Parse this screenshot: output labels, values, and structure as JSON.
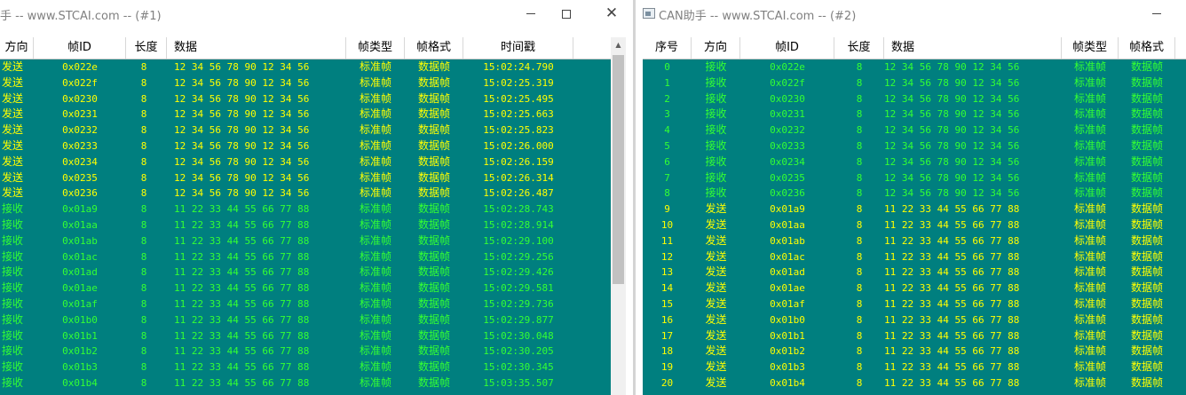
{
  "win1": {
    "title": "手 -- www.STCAI.com -- (#1)",
    "buttons": {
      "minimize": "minimize",
      "maximize": "maximize",
      "close": "close"
    },
    "columns": [
      "方向",
      "帧ID",
      "长度",
      "数据",
      "帧类型",
      "帧格式",
      "时间戳"
    ],
    "rows": [
      {
        "dir": "发送",
        "id": "0x022e",
        "len": "8",
        "data": "12 34 56 78 90 12 34 56",
        "type": "标准帧",
        "fmt": "数据帧",
        "ts": "15:02:24.790",
        "kind": "send"
      },
      {
        "dir": "发送",
        "id": "0x022f",
        "len": "8",
        "data": "12 34 56 78 90 12 34 56",
        "type": "标准帧",
        "fmt": "数据帧",
        "ts": "15:02:25.319",
        "kind": "send"
      },
      {
        "dir": "发送",
        "id": "0x0230",
        "len": "8",
        "data": "12 34 56 78 90 12 34 56",
        "type": "标准帧",
        "fmt": "数据帧",
        "ts": "15:02:25.495",
        "kind": "send"
      },
      {
        "dir": "发送",
        "id": "0x0231",
        "len": "8",
        "data": "12 34 56 78 90 12 34 56",
        "type": "标准帧",
        "fmt": "数据帧",
        "ts": "15:02:25.663",
        "kind": "send"
      },
      {
        "dir": "发送",
        "id": "0x0232",
        "len": "8",
        "data": "12 34 56 78 90 12 34 56",
        "type": "标准帧",
        "fmt": "数据帧",
        "ts": "15:02:25.823",
        "kind": "send"
      },
      {
        "dir": "发送",
        "id": "0x0233",
        "len": "8",
        "data": "12 34 56 78 90 12 34 56",
        "type": "标准帧",
        "fmt": "数据帧",
        "ts": "15:02:26.000",
        "kind": "send"
      },
      {
        "dir": "发送",
        "id": "0x0234",
        "len": "8",
        "data": "12 34 56 78 90 12 34 56",
        "type": "标准帧",
        "fmt": "数据帧",
        "ts": "15:02:26.159",
        "kind": "send"
      },
      {
        "dir": "发送",
        "id": "0x0235",
        "len": "8",
        "data": "12 34 56 78 90 12 34 56",
        "type": "标准帧",
        "fmt": "数据帧",
        "ts": "15:02:26.314",
        "kind": "send"
      },
      {
        "dir": "发送",
        "id": "0x0236",
        "len": "8",
        "data": "12 34 56 78 90 12 34 56",
        "type": "标准帧",
        "fmt": "数据帧",
        "ts": "15:02:26.487",
        "kind": "send"
      },
      {
        "dir": "接收",
        "id": "0x01a9",
        "len": "8",
        "data": "11 22 33 44 55 66 77 88",
        "type": "标准帧",
        "fmt": "数据帧",
        "ts": "15:02:28.743",
        "kind": "recv"
      },
      {
        "dir": "接收",
        "id": "0x01aa",
        "len": "8",
        "data": "11 22 33 44 55 66 77 88",
        "type": "标准帧",
        "fmt": "数据帧",
        "ts": "15:02:28.914",
        "kind": "recv"
      },
      {
        "dir": "接收",
        "id": "0x01ab",
        "len": "8",
        "data": "11 22 33 44 55 66 77 88",
        "type": "标准帧",
        "fmt": "数据帧",
        "ts": "15:02:29.100",
        "kind": "recv"
      },
      {
        "dir": "接收",
        "id": "0x01ac",
        "len": "8",
        "data": "11 22 33 44 55 66 77 88",
        "type": "标准帧",
        "fmt": "数据帧",
        "ts": "15:02:29.256",
        "kind": "recv"
      },
      {
        "dir": "接收",
        "id": "0x01ad",
        "len": "8",
        "data": "11 22 33 44 55 66 77 88",
        "type": "标准帧",
        "fmt": "数据帧",
        "ts": "15:02:29.426",
        "kind": "recv"
      },
      {
        "dir": "接收",
        "id": "0x01ae",
        "len": "8",
        "data": "11 22 33 44 55 66 77 88",
        "type": "标准帧",
        "fmt": "数据帧",
        "ts": "15:02:29.581",
        "kind": "recv"
      },
      {
        "dir": "接收",
        "id": "0x01af",
        "len": "8",
        "data": "11 22 33 44 55 66 77 88",
        "type": "标准帧",
        "fmt": "数据帧",
        "ts": "15:02:29.736",
        "kind": "recv"
      },
      {
        "dir": "接收",
        "id": "0x01b0",
        "len": "8",
        "data": "11 22 33 44 55 66 77 88",
        "type": "标准帧",
        "fmt": "数据帧",
        "ts": "15:02:29.877",
        "kind": "recv"
      },
      {
        "dir": "接收",
        "id": "0x01b1",
        "len": "8",
        "data": "11 22 33 44 55 66 77 88",
        "type": "标准帧",
        "fmt": "数据帧",
        "ts": "15:02:30.048",
        "kind": "recv"
      },
      {
        "dir": "接收",
        "id": "0x01b2",
        "len": "8",
        "data": "11 22 33 44 55 66 77 88",
        "type": "标准帧",
        "fmt": "数据帧",
        "ts": "15:02:30.205",
        "kind": "recv"
      },
      {
        "dir": "接收",
        "id": "0x01b3",
        "len": "8",
        "data": "11 22 33 44 55 66 77 88",
        "type": "标准帧",
        "fmt": "数据帧",
        "ts": "15:02:30.345",
        "kind": "recv"
      },
      {
        "dir": "接收",
        "id": "0x01b4",
        "len": "8",
        "data": "11 22 33 44 55 66 77 88",
        "type": "标准帧",
        "fmt": "数据帧",
        "ts": "15:03:35.507",
        "kind": "recv"
      }
    ]
  },
  "win2": {
    "title": "CAN助手 -- www.STCAI.com -- (#2)",
    "buttons": {
      "minimize": "minimize"
    },
    "columns": [
      "序号",
      "方向",
      "帧ID",
      "长度",
      "数据",
      "帧类型",
      "帧格式"
    ],
    "rows": [
      {
        "seq": "0",
        "dir": "接收",
        "id": "0x022e",
        "len": "8",
        "data": "12 34 56 78 90 12 34 56",
        "type": "标准帧",
        "fmt": "数据帧",
        "kind": "recv"
      },
      {
        "seq": "1",
        "dir": "接收",
        "id": "0x022f",
        "len": "8",
        "data": "12 34 56 78 90 12 34 56",
        "type": "标准帧",
        "fmt": "数据帧",
        "kind": "recv"
      },
      {
        "seq": "2",
        "dir": "接收",
        "id": "0x0230",
        "len": "8",
        "data": "12 34 56 78 90 12 34 56",
        "type": "标准帧",
        "fmt": "数据帧",
        "kind": "recv"
      },
      {
        "seq": "3",
        "dir": "接收",
        "id": "0x0231",
        "len": "8",
        "data": "12 34 56 78 90 12 34 56",
        "type": "标准帧",
        "fmt": "数据帧",
        "kind": "recv"
      },
      {
        "seq": "4",
        "dir": "接收",
        "id": "0x0232",
        "len": "8",
        "data": "12 34 56 78 90 12 34 56",
        "type": "标准帧",
        "fmt": "数据帧",
        "kind": "recv"
      },
      {
        "seq": "5",
        "dir": "接收",
        "id": "0x0233",
        "len": "8",
        "data": "12 34 56 78 90 12 34 56",
        "type": "标准帧",
        "fmt": "数据帧",
        "kind": "recv"
      },
      {
        "seq": "6",
        "dir": "接收",
        "id": "0x0234",
        "len": "8",
        "data": "12 34 56 78 90 12 34 56",
        "type": "标准帧",
        "fmt": "数据帧",
        "kind": "recv"
      },
      {
        "seq": "7",
        "dir": "接收",
        "id": "0x0235",
        "len": "8",
        "data": "12 34 56 78 90 12 34 56",
        "type": "标准帧",
        "fmt": "数据帧",
        "kind": "recv"
      },
      {
        "seq": "8",
        "dir": "接收",
        "id": "0x0236",
        "len": "8",
        "data": "12 34 56 78 90 12 34 56",
        "type": "标准帧",
        "fmt": "数据帧",
        "kind": "recv"
      },
      {
        "seq": "9",
        "dir": "发送",
        "id": "0x01a9",
        "len": "8",
        "data": "11 22 33 44 55 66 77 88",
        "type": "标准帧",
        "fmt": "数据帧",
        "kind": "send"
      },
      {
        "seq": "10",
        "dir": "发送",
        "id": "0x01aa",
        "len": "8",
        "data": "11 22 33 44 55 66 77 88",
        "type": "标准帧",
        "fmt": "数据帧",
        "kind": "send"
      },
      {
        "seq": "11",
        "dir": "发送",
        "id": "0x01ab",
        "len": "8",
        "data": "11 22 33 44 55 66 77 88",
        "type": "标准帧",
        "fmt": "数据帧",
        "kind": "send"
      },
      {
        "seq": "12",
        "dir": "发送",
        "id": "0x01ac",
        "len": "8",
        "data": "11 22 33 44 55 66 77 88",
        "type": "标准帧",
        "fmt": "数据帧",
        "kind": "send"
      },
      {
        "seq": "13",
        "dir": "发送",
        "id": "0x01ad",
        "len": "8",
        "data": "11 22 33 44 55 66 77 88",
        "type": "标准帧",
        "fmt": "数据帧",
        "kind": "send"
      },
      {
        "seq": "14",
        "dir": "发送",
        "id": "0x01ae",
        "len": "8",
        "data": "11 22 33 44 55 66 77 88",
        "type": "标准帧",
        "fmt": "数据帧",
        "kind": "send"
      },
      {
        "seq": "15",
        "dir": "发送",
        "id": "0x01af",
        "len": "8",
        "data": "11 22 33 44 55 66 77 88",
        "type": "标准帧",
        "fmt": "数据帧",
        "kind": "send"
      },
      {
        "seq": "16",
        "dir": "发送",
        "id": "0x01b0",
        "len": "8",
        "data": "11 22 33 44 55 66 77 88",
        "type": "标准帧",
        "fmt": "数据帧",
        "kind": "send"
      },
      {
        "seq": "17",
        "dir": "发送",
        "id": "0x01b1",
        "len": "8",
        "data": "11 22 33 44 55 66 77 88",
        "type": "标准帧",
        "fmt": "数据帧",
        "kind": "send"
      },
      {
        "seq": "18",
        "dir": "发送",
        "id": "0x01b2",
        "len": "8",
        "data": "11 22 33 44 55 66 77 88",
        "type": "标准帧",
        "fmt": "数据帧",
        "kind": "send"
      },
      {
        "seq": "19",
        "dir": "发送",
        "id": "0x01b3",
        "len": "8",
        "data": "11 22 33 44 55 66 77 88",
        "type": "标准帧",
        "fmt": "数据帧",
        "kind": "send"
      },
      {
        "seq": "20",
        "dir": "发送",
        "id": "0x01b4",
        "len": "8",
        "data": "11 22 33 44 55 66 77 88",
        "type": "标准帧",
        "fmt": "数据帧",
        "kind": "send"
      }
    ]
  },
  "colors": {
    "list_bg": "#007f7f",
    "send": "#ffff00",
    "recv": "#33ff33"
  }
}
